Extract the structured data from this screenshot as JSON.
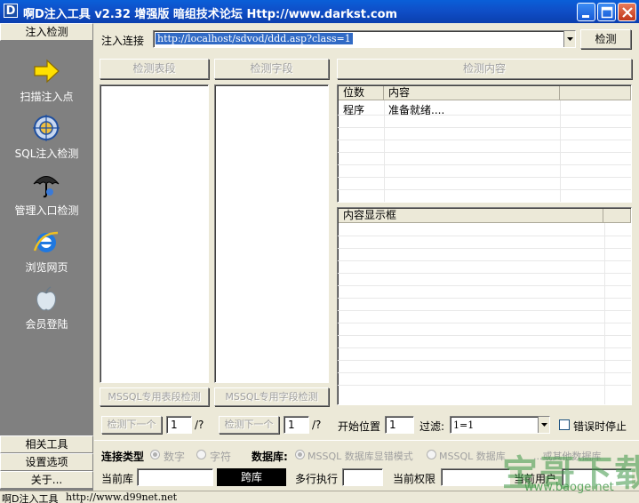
{
  "window": {
    "app_icon_letter": "D",
    "title": "啊D注入工具 v2.32 增强版 暗组技术论坛 Http://www.darkst.com"
  },
  "sidebar": {
    "top_tab": "注入检测",
    "items": [
      {
        "label": "扫描注入点",
        "icon": "arrow-icon"
      },
      {
        "label": "SQL注入检测",
        "icon": "target-icon"
      },
      {
        "label": "管理入口检测",
        "icon": "umbrella-icon"
      },
      {
        "label": "浏览网页",
        "icon": "ie-icon"
      },
      {
        "label": "会员登陆",
        "icon": "apple-icon"
      }
    ],
    "bottom_tabs": [
      "相关工具",
      "设置选项",
      "关于..."
    ]
  },
  "inject": {
    "url_label": "注入连接",
    "url_value": "http://localhost/sdvod/ddd.asp?class=1",
    "detect_button": "检测"
  },
  "panels": {
    "detect_tables": "检测表段",
    "detect_fields": "检测字段",
    "detect_content": "检测内容",
    "mssql_tables": "MSSQL专用表段检测",
    "mssql_fields": "MSSQL专用字段检测",
    "next1": "检测下一个",
    "next1_value": "1",
    "next1_total": "/?",
    "next2": "检测下一个",
    "next2_value": "1",
    "next2_total": "/?"
  },
  "content_list": {
    "columns": [
      "位数",
      "内容"
    ],
    "rows": [
      {
        "pos": "程序",
        "content": "准备就绪...."
      }
    ]
  },
  "content_display": {
    "header": "内容显示框"
  },
  "options": {
    "start_pos_label": "开始位置",
    "start_pos_value": "1",
    "filter_label": "过滤:",
    "filter_value": "1=1",
    "stop_on_error": "错误时停止"
  },
  "connection": {
    "type_label": "连接类型",
    "type_options": [
      "数字",
      "字符"
    ],
    "db_label": "数据库:",
    "db_options": [
      "MSSQL 数据库显错模式",
      "MSSQL 数据库",
      "...或其他数据库"
    ]
  },
  "status_row": {
    "current_db_label": "当前库",
    "jump_button": "跨库",
    "multi_exec_label": "多行执行",
    "current_perm_label": "当前权限",
    "current_user_label": "当前用户"
  },
  "statusbar": {
    "app_name": "啊D注入工具",
    "url": "http://www.d99net.net"
  },
  "watermark": {
    "text": "宝哥下载",
    "url": "www.baoge.net"
  }
}
